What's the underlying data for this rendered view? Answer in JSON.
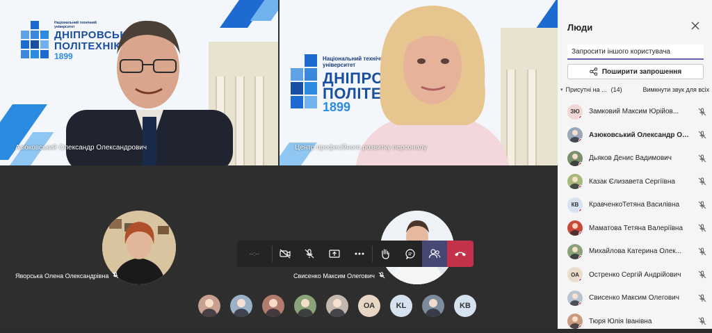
{
  "tiles": [
    {
      "name": "Азюковський Олександр Олександрович"
    },
    {
      "name": "Центр професійного розвитку персоналу"
    }
  ],
  "logo": {
    "small_text": "Національний технічний університет",
    "big_text_1": "ДНІПРОВСЬКА",
    "big_text_2": "ПОЛІТЕХНІКА",
    "year": "1899"
  },
  "circle_tiles": [
    {
      "name": "Яворська Олена Олександрівна"
    },
    {
      "name": "Свисенко Максим Олегович"
    }
  ],
  "controls": {
    "timer": "--:--",
    "items": [
      "camera-off-icon",
      "mic-off-icon",
      "share-screen-icon",
      "more-icon",
      "raise-hand-icon",
      "chat-icon",
      "participants-icon",
      "hang-up-icon"
    ]
  },
  "bottom_avatars": [
    {
      "initials": "",
      "color": "#c8a090"
    },
    {
      "initials": "",
      "color": "#9ab1c8"
    },
    {
      "initials": "",
      "color": "#b37c6e"
    },
    {
      "initials": "",
      "color": "#8aa37a"
    },
    {
      "initials": "",
      "color": "#c2b8ad"
    },
    {
      "initials": "ОА",
      "color": "#e8d6c5"
    },
    {
      "initials": "KL",
      "color": "#d6e2ef"
    },
    {
      "initials": "",
      "color": "#7c8c9c"
    },
    {
      "initials": "KB",
      "color": "#d6e2ef"
    }
  ],
  "panel": {
    "title": "Люди",
    "invite_placeholder": "Запросити іншого користувача",
    "share_label": "Поширити запрошення",
    "present_label": "Присутні на ...",
    "present_count": "(14)",
    "mute_all": "Вимкнути звук для всіх",
    "participants": [
      {
        "initials": "ЗЮ",
        "name": "Замковий Максим Юрійов...",
        "color": "#f3d6d6",
        "bold": false
      },
      {
        "initials": "",
        "name": "Азюковський Олександр Оле...",
        "color": "#9aa7b8",
        "bold": true
      },
      {
        "initials": "",
        "name": "Дьяков Денис Вадимович",
        "color": "#7a8f6c",
        "bold": false
      },
      {
        "initials": "",
        "name": "Казак Єлизавета Сергіївна",
        "color": "#a8b87a",
        "bold": false
      },
      {
        "initials": "КВ",
        "name": "КравченкоТетяна Василівна",
        "color": "#d6e2ef",
        "bold": false
      },
      {
        "initials": "",
        "name": "Маматова Тетяна Валеріївна",
        "color": "#c84a3a",
        "bold": false
      },
      {
        "initials": "",
        "name": "Михайлова Катерина Олек...",
        "color": "#8ca07a",
        "bold": false
      },
      {
        "initials": "ОА",
        "name": "Остренко Сергій Андрійович",
        "color": "#ecdccd",
        "bold": false
      },
      {
        "initials": "",
        "name": "Свисенко Максим Олегович",
        "color": "#b8c4d0",
        "bold": false
      },
      {
        "initials": "",
        "name": "Тюря Юлія Іванівна",
        "color": "#c89a80",
        "bold": false
      }
    ]
  },
  "colors": {
    "accent": "#6264a7",
    "hangup": "#c4314b",
    "brand_blue": "#1d6bd0"
  }
}
